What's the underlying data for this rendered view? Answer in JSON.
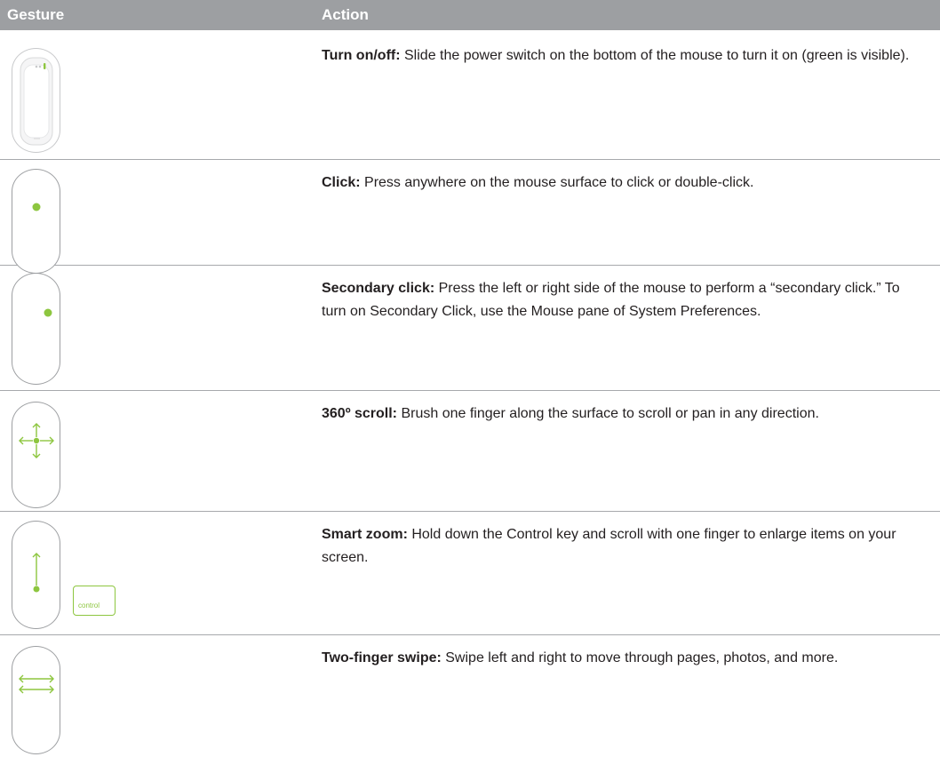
{
  "columns": {
    "gesture": "Gesture",
    "action": "Action"
  },
  "accent_color": "#8dc63f",
  "header_color": "#9d9fa2",
  "rows": [
    {
      "icon": "mouse-power-switch-icon",
      "term": "Turn on/off:",
      "text": " Slide the power switch on the bottom of the mouse to turn it on (green is visible)."
    },
    {
      "icon": "mouse-click-icon",
      "term": "Click:",
      "text": " Press anywhere on the mouse surface to click or double-click."
    },
    {
      "icon": "mouse-secondary-click-icon",
      "term": "Secondary click:",
      "text": " Press the left or right side of the mouse to perform a “secondary click.” To turn on Secondary Click, use the Mouse pane of System Preferences."
    },
    {
      "icon": "mouse-scroll-icon",
      "term": "360º scroll:",
      "text": " Brush one finger along the surface to scroll or pan in any direction."
    },
    {
      "icon": "mouse-smart-zoom-icon",
      "term": "Smart zoom:",
      "text": " Hold down the Control key and scroll with one finger to enlarge items on your screen.",
      "key_label": "control"
    },
    {
      "icon": "mouse-two-finger-swipe-icon",
      "term": "Two-finger swipe:",
      "text": " Swipe left and right to move through pages, photos, and more."
    }
  ]
}
